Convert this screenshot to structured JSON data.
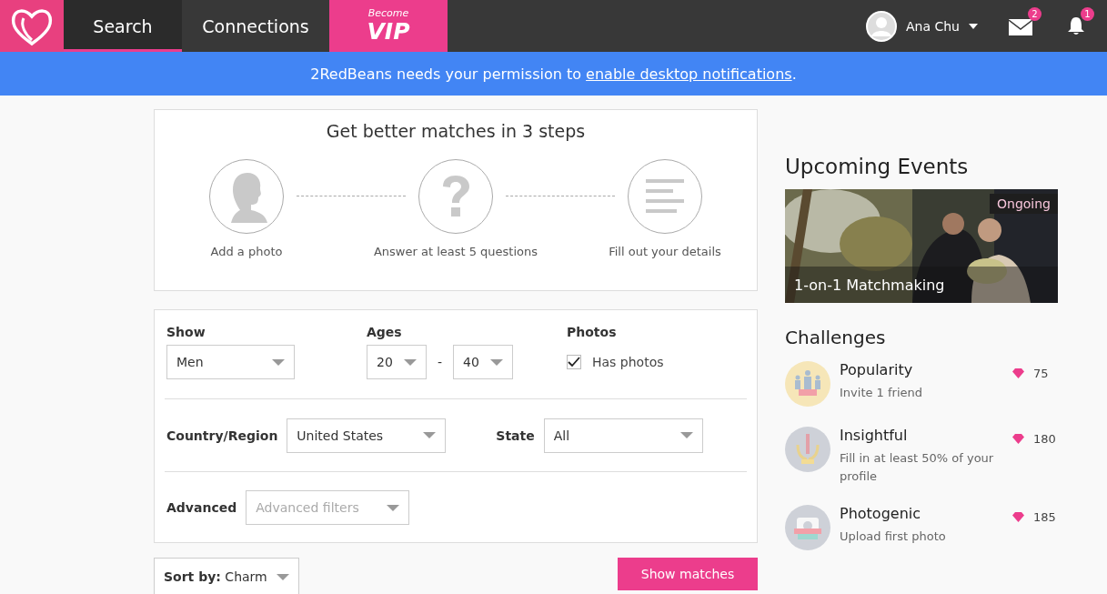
{
  "nav": {
    "tabs": [
      {
        "label": "Search",
        "selected": true
      },
      {
        "label": "Connections",
        "selected": false
      }
    ],
    "vip": {
      "top": "Become",
      "main": "VIP"
    },
    "user": {
      "name": "Ana Chu"
    },
    "messages_badge": "2",
    "notifications_badge": "1"
  },
  "banner": {
    "text": "2RedBeans needs your permission to ",
    "link": "enable desktop notifications",
    "end": "."
  },
  "steps": {
    "title": "Get better matches in 3 steps",
    "items": [
      {
        "label": "Add a photo"
      },
      {
        "kind": "question",
        "label": "Answer at least 5 questions"
      },
      {
        "kind": "details",
        "label": "Fill out your details"
      }
    ]
  },
  "filters": {
    "show": {
      "label": "Show",
      "value": "Men"
    },
    "ages": {
      "label": "Ages",
      "min": "20",
      "separator": "-",
      "max": "40"
    },
    "photos": {
      "label": "Photos",
      "option": "Has photos",
      "checked": true
    },
    "country": {
      "label": "Country/Region",
      "value": "United States"
    },
    "state": {
      "label": "State",
      "value": "All"
    },
    "advanced": {
      "label": "Advanced",
      "placeholder": "Advanced filters"
    }
  },
  "sort": {
    "text": "**Sort by:** Charm"
  },
  "show_button": "Show matches",
  "events": {
    "title": "Upcoming Events",
    "items": [
      {
        "kind": "picture",
        "title": "1-on-1 Matchmaking",
        "badge": "Ongoing"
      }
    ]
  },
  "challenges": {
    "title": "Challenges",
    "items": [
      {
        "kind": "popularity",
        "title": "Popularity",
        "description": "Invite 1 friend",
        "points": "75"
      },
      {
        "kind": "insightful",
        "title": "Insightful",
        "description": "Fill in at least 50% of your profile",
        "points": "180"
      },
      {
        "kind": "photogenic",
        "title": "Photogenic",
        "description": "Upload first photo",
        "points": "185"
      }
    ]
  }
}
